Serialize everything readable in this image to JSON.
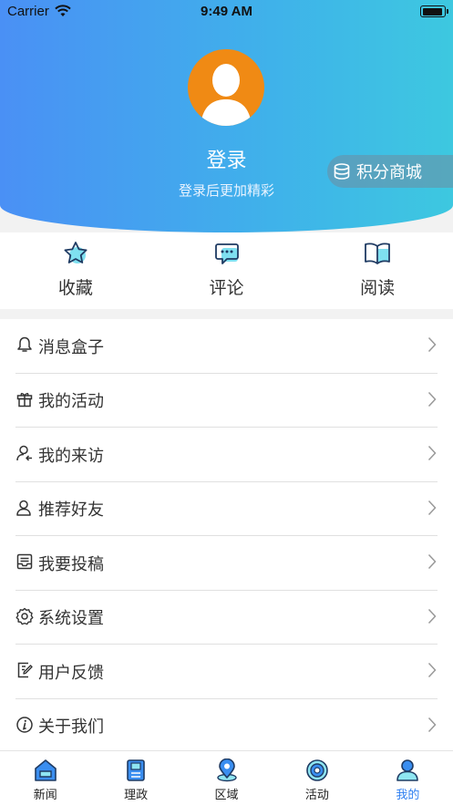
{
  "status_bar": {
    "carrier": "Carrier",
    "time": "9:49 AM"
  },
  "profile": {
    "login_title": "登录",
    "login_subtitle": "登录后更加精彩"
  },
  "points_mall": {
    "label": "积分商城"
  },
  "quick_actions": [
    {
      "label": "收藏",
      "icon": "star-icon"
    },
    {
      "label": "评论",
      "icon": "comment-icon"
    },
    {
      "label": "阅读",
      "icon": "book-icon"
    }
  ],
  "menu": [
    {
      "label": "消息盒子",
      "icon": "bell-icon"
    },
    {
      "label": "我的活动",
      "icon": "gift-icon"
    },
    {
      "label": "我的来访",
      "icon": "visitor-icon"
    },
    {
      "label": "推荐好友",
      "icon": "user-icon"
    },
    {
      "label": "我要投稿",
      "icon": "submit-icon"
    },
    {
      "label": "系统设置",
      "icon": "gear-icon"
    },
    {
      "label": "用户反馈",
      "icon": "feedback-icon"
    },
    {
      "label": "关于我们",
      "icon": "info-icon"
    }
  ],
  "tabs": [
    {
      "label": "新闻",
      "icon": "news-icon"
    },
    {
      "label": "理政",
      "icon": "government-icon"
    },
    {
      "label": "区域",
      "icon": "location-icon"
    },
    {
      "label": "活动",
      "icon": "activity-icon"
    },
    {
      "label": "我的",
      "icon": "profile-icon",
      "active": true
    }
  ],
  "colors": {
    "header_start": "#4a90f5",
    "header_end": "#3dc8e0",
    "avatar": "#f08a14",
    "tab_active": "#2f7ff0"
  }
}
